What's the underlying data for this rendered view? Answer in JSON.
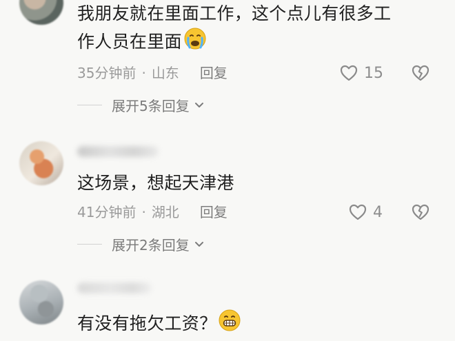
{
  "comments": [
    {
      "text_line1": "我朋友就在里面工作，这个点儿有很多工",
      "text_line2": "作人员在里面",
      "time": "35分钟前",
      "location": "山东",
      "reply_label": "回复",
      "likes": "15",
      "expand_label": "展开5条回复"
    },
    {
      "text": "这场景，想起天津港",
      "time": "41分钟前",
      "location": "湖北",
      "reply_label": "回复",
      "likes": "4",
      "expand_label": "展开2条回复"
    },
    {
      "text": "有没有拖欠工资？"
    }
  ],
  "separator": "·"
}
